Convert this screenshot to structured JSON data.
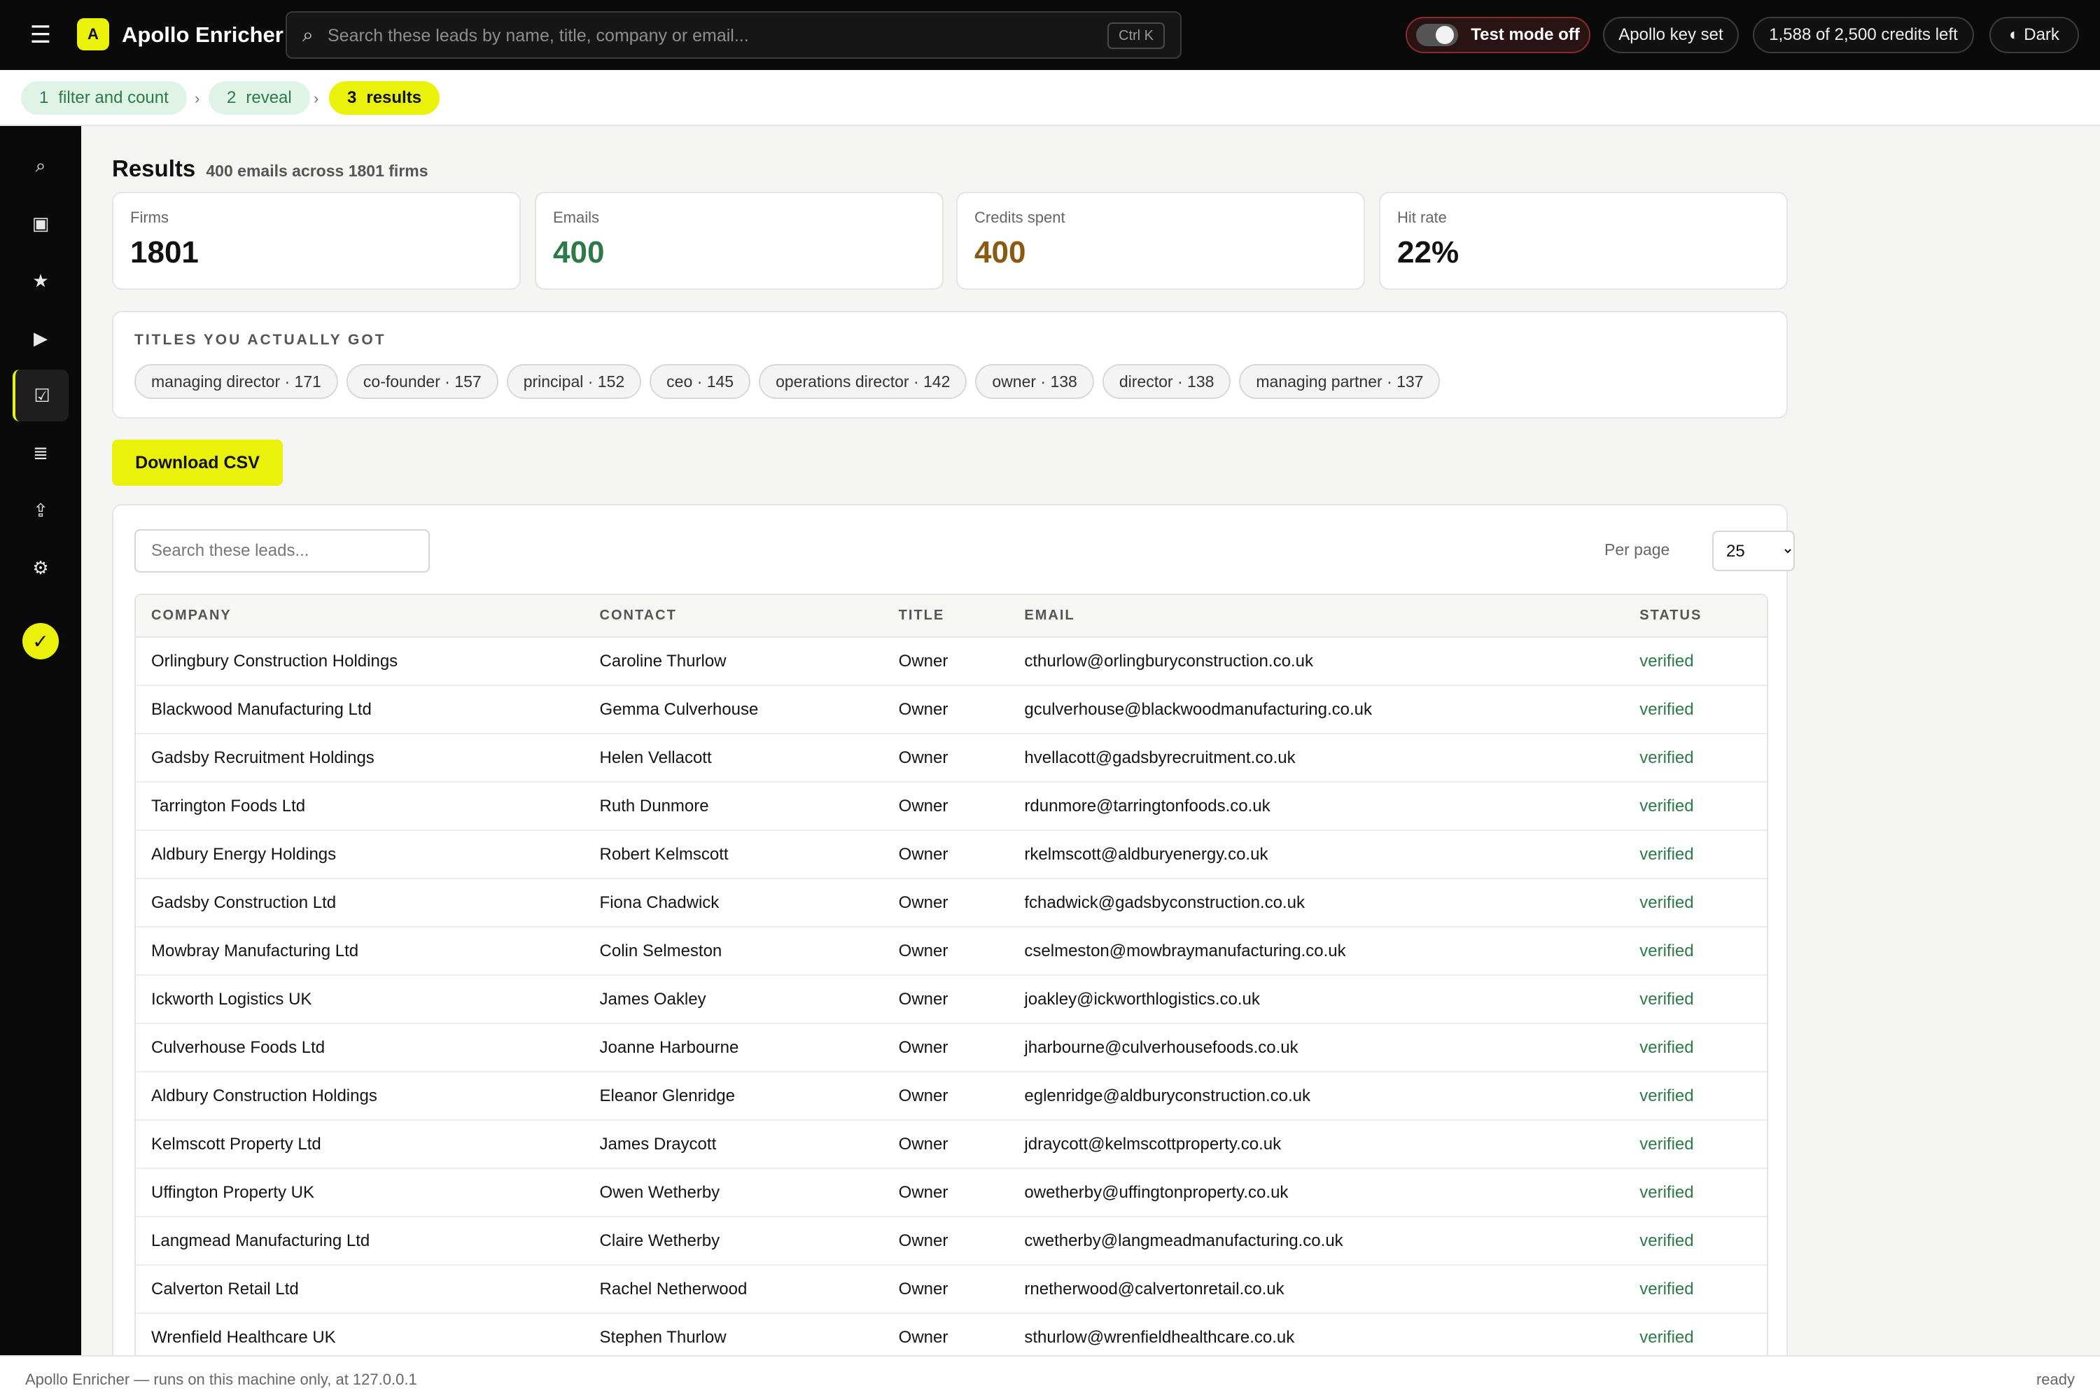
{
  "app": {
    "logo_letter": "A",
    "title": "Apollo Enricher"
  },
  "search": {
    "placeholder": "Search these leads by name, title, company or email...",
    "shortcut": "Ctrl K"
  },
  "header": {
    "test_mode_label": "Test mode off",
    "test_mode_on": false,
    "key_status": "Apollo key set",
    "credits": "1,588 of 2,500 credits left",
    "theme_label": "◐ Dark"
  },
  "steps": [
    {
      "num": "1",
      "label": "filter and count"
    },
    {
      "num": "2",
      "label": "reveal"
    },
    {
      "num": "3",
      "label": "results"
    }
  ],
  "sidebar": {
    "icons": [
      "search-icon",
      "stop-icon",
      "star-icon",
      "play-icon",
      "checkbox-icon",
      "list-icon",
      "bulb-icon",
      "gear-icon"
    ],
    "glyphs": [
      "⌕",
      "▣",
      "★",
      "▶",
      "☑",
      "≣",
      "⇪",
      "⚙"
    ],
    "active_index": 4,
    "status_glyph": "✓"
  },
  "results": {
    "title": "Results",
    "subtitle": "400 emails across 1801 firms",
    "stats": [
      {
        "label": "Firms",
        "value": "1801"
      },
      {
        "label": "Emails",
        "value": "400"
      },
      {
        "label": "Credits spent",
        "value": "400"
      },
      {
        "label": "Hit rate",
        "value": "22%"
      }
    ],
    "titles_heading": "TITLES YOU ACTUALLY GOT",
    "title_chips": [
      "managing director · 171",
      "co-founder · 157",
      "principal · 152",
      "ceo · 145",
      "operations director · 142",
      "owner · 138",
      "director · 138",
      "managing partner · 137"
    ],
    "download_label": "Download CSV"
  },
  "table": {
    "search_placeholder": "Search these leads...",
    "per_page_label": "Per page",
    "per_page_value": "25",
    "columns": [
      "COMPANY",
      "CONTACT",
      "TITLE",
      "EMAIL",
      "STATUS"
    ],
    "rows": [
      [
        "Orlingbury Construction Holdings",
        "Caroline Thurlow",
        "Owner",
        "cthurlow@orlingburyconstruction.co.uk",
        "verified"
      ],
      [
        "Blackwood Manufacturing Ltd",
        "Gemma Culverhouse",
        "Owner",
        "gculverhouse@blackwoodmanufacturing.co.uk",
        "verified"
      ],
      [
        "Gadsby Recruitment Holdings",
        "Helen Vellacott",
        "Owner",
        "hvellacott@gadsbyrecruitment.co.uk",
        "verified"
      ],
      [
        "Tarrington Foods Ltd",
        "Ruth Dunmore",
        "Owner",
        "rdunmore@tarringtonfoods.co.uk",
        "verified"
      ],
      [
        "Aldbury Energy Holdings",
        "Robert Kelmscott",
        "Owner",
        "rkelmscott@aldburyenergy.co.uk",
        "verified"
      ],
      [
        "Gadsby Construction Ltd",
        "Fiona Chadwick",
        "Owner",
        "fchadwick@gadsbyconstruction.co.uk",
        "verified"
      ],
      [
        "Mowbray Manufacturing Ltd",
        "Colin Selmeston",
        "Owner",
        "cselmeston@mowbraymanufacturing.co.uk",
        "verified"
      ],
      [
        "Ickworth Logistics UK",
        "James Oakley",
        "Owner",
        "joakley@ickworthlogistics.co.uk",
        "verified"
      ],
      [
        "Culverhouse Foods Ltd",
        "Joanne Harbourne",
        "Owner",
        "jharbourne@culverhousefoods.co.uk",
        "verified"
      ],
      [
        "Aldbury Construction Holdings",
        "Eleanor Glenridge",
        "Owner",
        "eglenridge@aldburyconstruction.co.uk",
        "verified"
      ],
      [
        "Kelmscott Property Ltd",
        "James Draycott",
        "Owner",
        "jdraycott@kelmscottproperty.co.uk",
        "verified"
      ],
      [
        "Uffington Property UK",
        "Owen Wetherby",
        "Owner",
        "owetherby@uffingtonproperty.co.uk",
        "verified"
      ],
      [
        "Langmead Manufacturing Ltd",
        "Claire Wetherby",
        "Owner",
        "cwetherby@langmeadmanufacturing.co.uk",
        "verified"
      ],
      [
        "Calverton Retail Ltd",
        "Rachel Netherwood",
        "Owner",
        "rnetherwood@calvertonretail.co.uk",
        "verified"
      ],
      [
        "Wrenfield Healthcare UK",
        "Stephen Thurlow",
        "Owner",
        "sthurlow@wrenfieldhealthcare.co.uk",
        "verified"
      ]
    ]
  },
  "footer": {
    "left": "Apollo Enricher — runs on this machine only, at 127.0.0.1",
    "right": "ready"
  },
  "colors": {
    "accent": "#eaf20c",
    "verified": "#2d7a48",
    "credits_spent": "#8a5a12",
    "topbar": "#0a0a0a"
  }
}
